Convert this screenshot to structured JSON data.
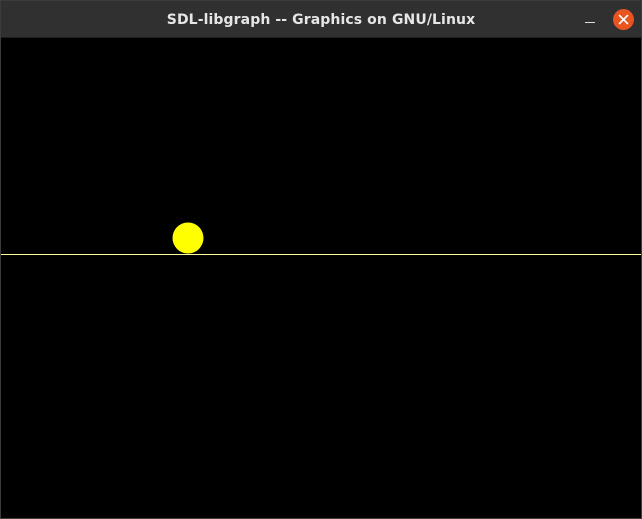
{
  "window": {
    "title": "SDL-libgraph -- Graphics on GNU/Linux"
  },
  "controls": {
    "minimize_icon": "minimize-icon",
    "close_icon": "close-icon"
  },
  "colors": {
    "titlebar": "#303030",
    "title_text": "#e6e6e6",
    "close_button": "#e95420",
    "canvas_background": "#000000",
    "ground_line": "#ffff99",
    "ball": "#ffff00"
  }
}
